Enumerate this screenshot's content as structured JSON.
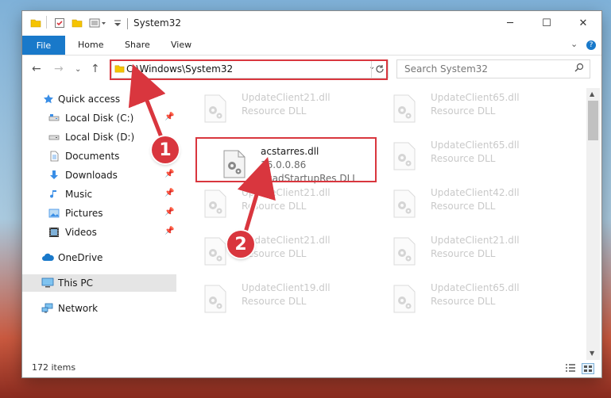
{
  "window": {
    "title": "System32",
    "controls": {
      "minimize": "─",
      "maximize": "☐",
      "close": "✕"
    }
  },
  "ribbon": {
    "tabs": [
      {
        "label": "File"
      },
      {
        "label": "Share"
      },
      {
        "label": "View"
      }
    ],
    "home_label": "Home",
    "expand_icon": "⌄",
    "help_icon": "?"
  },
  "navigation": {
    "back": "←",
    "forward": "→",
    "recent": "⌄",
    "up": "↑",
    "address": "C:\\Windows\\System32",
    "search_placeholder": "Search System32"
  },
  "sidebar": {
    "items": [
      {
        "label": "Quick access",
        "icon": "star-icon"
      },
      {
        "label": "Local Disk (C:)",
        "icon": "drive-icon"
      },
      {
        "label": "Local Disk (D:)",
        "icon": "drive-icon"
      },
      {
        "label": "Documents",
        "icon": "documents-icon"
      },
      {
        "label": "Downloads",
        "icon": "download-icon"
      },
      {
        "label": "Music",
        "icon": "music-icon"
      },
      {
        "label": "Pictures",
        "icon": "pictures-icon"
      },
      {
        "label": "Videos",
        "icon": "videos-icon"
      },
      {
        "label": "OneDrive",
        "icon": "cloud-icon"
      },
      {
        "label": "This PC",
        "icon": "computer-icon"
      },
      {
        "label": "Network",
        "icon": "network-icon"
      }
    ]
  },
  "files": {
    "left": [
      {
        "name": "UpdateClient21.dll",
        "desc": "Resource DLL"
      },
      {
        "name": "acstarres.dll",
        "version": "16.0.0.86",
        "desc": "AcadStartupRes DLL"
      },
      {
        "name": "UpdateClient21.dll",
        "desc": "Resource DLL"
      },
      {
        "name": "UpdateClient21.dll",
        "desc": "Resource DLL"
      },
      {
        "name": "UpdateClient19.dll",
        "desc": "Resource DLL"
      }
    ],
    "right": [
      {
        "name": "UpdateClient65.dll",
        "desc": "Resource DLL"
      },
      {
        "name": "UpdateClient65.dll",
        "desc": "Resource DLL"
      },
      {
        "name": "UpdateClient42.dll",
        "desc": "Resource DLL"
      },
      {
        "name": "UpdateClient21.dll",
        "desc": "Resource DLL"
      },
      {
        "name": "UpdateClient65.dll",
        "desc": "Resource DLL"
      }
    ]
  },
  "status": {
    "item_count": "172 items"
  },
  "annotations": {
    "step1": "1",
    "step2": "2"
  },
  "colors": {
    "accent": "#1979ca",
    "highlight": "#d9363e"
  }
}
